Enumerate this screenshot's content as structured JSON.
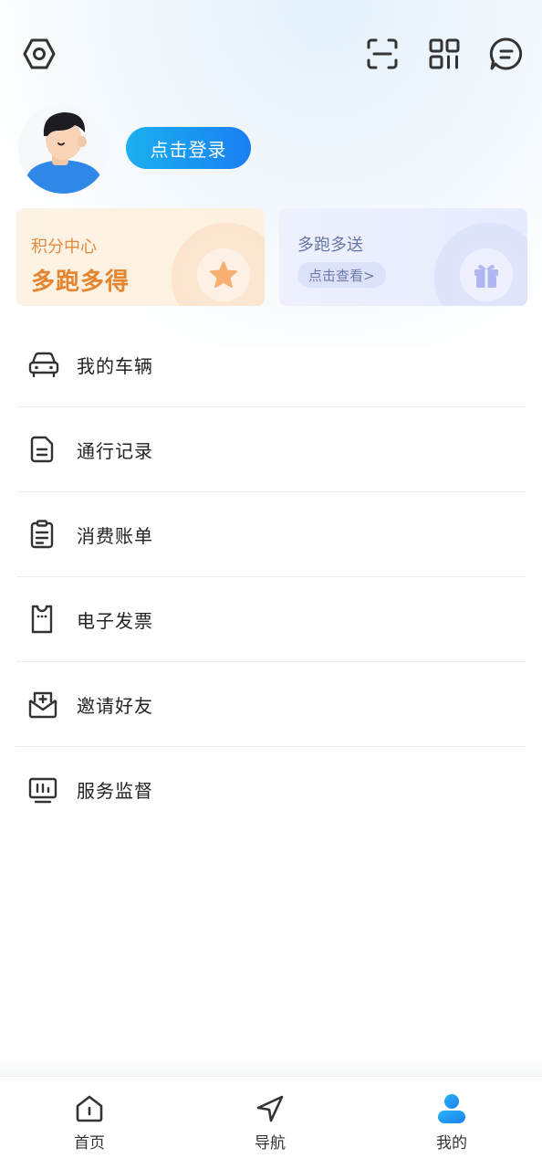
{
  "header": {
    "icons": [
      "settings-hexagon-icon",
      "scan-icon",
      "qr-code-icon",
      "message-icon"
    ]
  },
  "profile": {
    "login_label": "点击登录"
  },
  "cards": {
    "points": {
      "title": "积分中心",
      "headline": "多跑多得",
      "icon": "star-icon"
    },
    "gift": {
      "title": "多跑多送",
      "button": "点击查看>",
      "icon": "gift-icon"
    }
  },
  "menu": [
    {
      "label": "我的车辆",
      "icon": "car-icon"
    },
    {
      "label": "通行记录",
      "icon": "document-icon"
    },
    {
      "label": "消费账单",
      "icon": "clipboard-icon"
    },
    {
      "label": "电子发票",
      "icon": "invoice-icon"
    },
    {
      "label": "邀请好友",
      "icon": "envelope-icon"
    },
    {
      "label": "服务监督",
      "icon": "monitor-icon"
    }
  ],
  "tabbar": {
    "items": [
      {
        "label": "首页",
        "icon": "home-icon",
        "active": false
      },
      {
        "label": "导航",
        "icon": "navigation-icon",
        "active": false
      },
      {
        "label": "我的",
        "icon": "user-icon",
        "active": true
      }
    ]
  },
  "colors": {
    "accent_blue": "#1a7ff2",
    "points_orange": "#e6852f",
    "gift_purple": "#6675a6"
  }
}
